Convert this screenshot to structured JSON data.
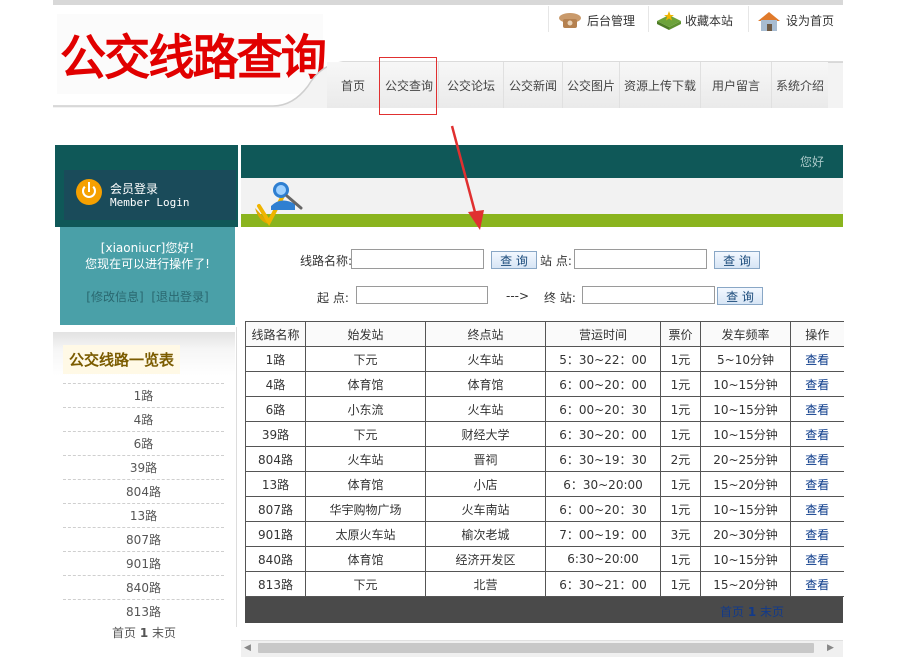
{
  "header": {
    "logo_text": "公交线路查询",
    "top_links": [
      {
        "label": "后台管理",
        "icon": "phone-icon"
      },
      {
        "label": "收藏本站",
        "icon": "star-box-icon"
      },
      {
        "label": "设为首页",
        "icon": "home-icon"
      }
    ],
    "nav": [
      "首页",
      "公交查询",
      "公交论坛",
      "公交新闻",
      "公交图片",
      "资源上传下载",
      "用户留言",
      "系统介绍"
    ],
    "active_nav": "公交查询"
  },
  "login": {
    "title_cn": "会员登录",
    "title_en": "Member Login",
    "welcome_line1": "[xiaoniucr]您好!",
    "welcome_line2": "您现在可以进行操作了!",
    "edit_link": "[修改信息]",
    "logout_link": "[退出登录]"
  },
  "route_list": {
    "title": "公交线路一览表",
    "items": [
      "1路",
      "4路",
      "6路",
      "39路",
      "804路",
      "13路",
      "807路",
      "901路",
      "840路",
      "813路"
    ],
    "pager": {
      "first": "首页",
      "current": "1",
      "last": "末页"
    }
  },
  "banner": {
    "greeting": "您好"
  },
  "search": {
    "line_label": "线路名称:",
    "line_value": "",
    "query_label": "查 询",
    "station_label": "站  点:",
    "station_value": "",
    "from_label": "起  点:",
    "from_value": "",
    "arrow_text": "--->",
    "to_label": "终  站:",
    "to_value": ""
  },
  "table": {
    "headers": [
      "线路名称",
      "始发站",
      "终点站",
      "营运时间",
      "票价",
      "发车频率",
      "操作"
    ],
    "rows": [
      [
        "1路",
        "下元",
        "火车站",
        "5：30~22：00",
        "1元",
        "5~10分钟",
        "查看"
      ],
      [
        "4路",
        "体育馆",
        "体育馆",
        "6：00~20：00",
        "1元",
        "10~15分钟",
        "查看"
      ],
      [
        "6路",
        "小东流",
        "火车站",
        "6：00~20：30",
        "1元",
        "10~15分钟",
        "查看"
      ],
      [
        "39路",
        "下元",
        "财经大学",
        "6：30~20：00",
        "1元",
        "10~15分钟",
        "查看"
      ],
      [
        "804路",
        "火车站",
        "晋祠",
        "6：30~19：30",
        "2元",
        "20~25分钟",
        "查看"
      ],
      [
        "13路",
        "体育馆",
        "小店",
        "6：30~20:00",
        "1元",
        "15~20分钟",
        "查看"
      ],
      [
        "807路",
        "华宇购物广场",
        "火车南站",
        "6：00~20：30",
        "1元",
        "10~15分钟",
        "查看"
      ],
      [
        "901路",
        "太原火车站",
        "榆次老城",
        "7：00~19：00",
        "3元",
        "20~30分钟",
        "查看"
      ],
      [
        "840路",
        "体育馆",
        "经济开发区",
        "6:30~20:00",
        "1元",
        "10~15分钟",
        "查看"
      ],
      [
        "813路",
        "下元",
        "北营",
        "6：30~21：00",
        "1元",
        "15~20分钟",
        "查看"
      ]
    ],
    "pager": {
      "first": "首页",
      "current": "1",
      "last": "末页"
    }
  },
  "colors": {
    "dark_teal": "#0f5858",
    "accent_green": "#8ab41e",
    "logo_red": "#e10000",
    "annotation_red": "#e03030"
  }
}
